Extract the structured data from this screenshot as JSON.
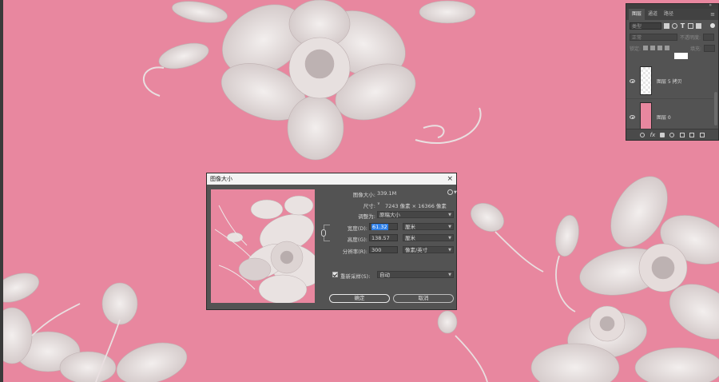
{
  "layers_panel": {
    "tabs": [
      "图层",
      "通道",
      "路径"
    ],
    "filter_placeholder": "类型",
    "blend_mode": "正常",
    "opacity_label": "不透明度:",
    "lock_label": "锁定:",
    "fill_label": "填充:",
    "layers": [
      {
        "name": "图层 5 拷贝",
        "thumb": "transparent"
      },
      {
        "name": "图层 0",
        "thumb": "pink"
      }
    ]
  },
  "dialog": {
    "title": "图像大小",
    "image_size_label": "图像大小:",
    "image_size_value": "339.1M",
    "dimensions_label": "尺寸:",
    "dimensions_value": "7243 像素 × 16366 像素",
    "fit_to_label": "调整为:",
    "fit_to_value": "原稿大小",
    "width_label": "宽度(D):",
    "width_value": "61.32",
    "width_unit": "厘米",
    "height_label": "高度(G):",
    "height_value": "138.57",
    "height_unit": "厘米",
    "resolution_label": "分辨率(R):",
    "resolution_value": "300",
    "resolution_unit": "像素/英寸",
    "resample_label": "重新采样(S):",
    "resample_value": "自动",
    "ok_label": "确定",
    "cancel_label": "取消"
  },
  "colors": {
    "canvas_pink": "#e8879f",
    "panel_gray": "#535353",
    "selection_blue": "#2d7ee6"
  }
}
